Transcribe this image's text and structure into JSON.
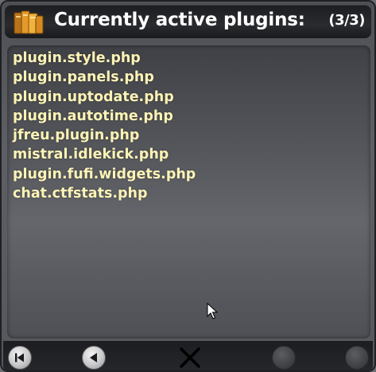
{
  "header": {
    "title": "Currently active plugins:",
    "page_count": "(3/3)",
    "icon": "folder-stack-icon"
  },
  "plugins": [
    "plugin.style.php",
    "plugin.panels.php",
    "plugin.uptodate.php",
    "plugin.autotime.php",
    "jfreu.plugin.php",
    "mistral.idlekick.php",
    "plugin.fufi.widgets.php",
    "chat.ctfstats.php"
  ],
  "footer": {
    "buttons": [
      {
        "name": "first-page-button",
        "icon": "skip-to-start-icon",
        "enabled": true
      },
      {
        "name": "previous-page-button",
        "icon": "triangle-left-icon",
        "enabled": true
      },
      {
        "name": "close-button",
        "icon": "close-icon",
        "enabled": true
      },
      {
        "name": "next-page-button",
        "icon": "triangle-right-icon",
        "enabled": false
      },
      {
        "name": "last-page-button",
        "icon": "skip-to-end-icon",
        "enabled": false
      }
    ]
  },
  "colors": {
    "plugin_text": "#fdf3b6",
    "title_text": "#ffffff",
    "titlebar_bg": "#1c1d20",
    "content_bg": "#5a5c61"
  }
}
